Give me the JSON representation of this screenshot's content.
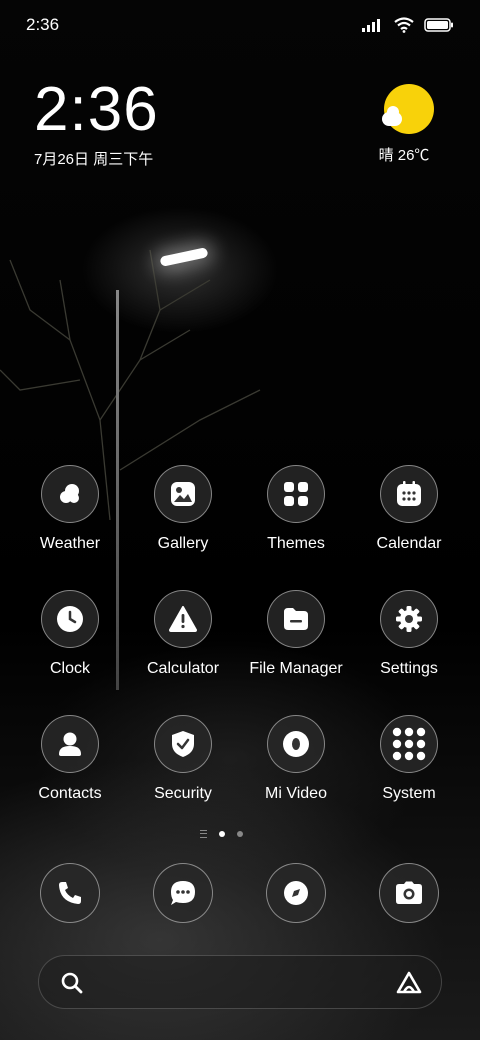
{
  "status_bar": {
    "time": "2:36"
  },
  "clock_widget": {
    "time": "2:36",
    "date": "7月26日 周三下午"
  },
  "weather_widget": {
    "text": "晴 26℃",
    "sun_color": "#f8d20a"
  },
  "apps": [
    {
      "label": "Weather",
      "icon": "weather-icon"
    },
    {
      "label": "Gallery",
      "icon": "gallery-icon"
    },
    {
      "label": "Themes",
      "icon": "themes-icon"
    },
    {
      "label": "Calendar",
      "icon": "calendar-icon"
    },
    {
      "label": "Clock",
      "icon": "clock-icon"
    },
    {
      "label": "Calculator",
      "icon": "warning-icon"
    },
    {
      "label": "File Manager",
      "icon": "folder-icon"
    },
    {
      "label": "Settings",
      "icon": "gear-icon"
    },
    {
      "label": "Contacts",
      "icon": "person-icon"
    },
    {
      "label": "Security",
      "icon": "shield-icon"
    },
    {
      "label": "Mi Video",
      "icon": "play-icon"
    },
    {
      "label": "System",
      "icon": "folder-grid-icon"
    }
  ],
  "dock": [
    {
      "icon": "phone-icon"
    },
    {
      "icon": "message-icon"
    },
    {
      "icon": "compass-icon"
    },
    {
      "icon": "camera-icon"
    }
  ],
  "page_indicator": {
    "pages": 2,
    "current": 1
  },
  "search_bar": {
    "icon": "search-icon",
    "assistant_icon": "assistant-icon"
  }
}
